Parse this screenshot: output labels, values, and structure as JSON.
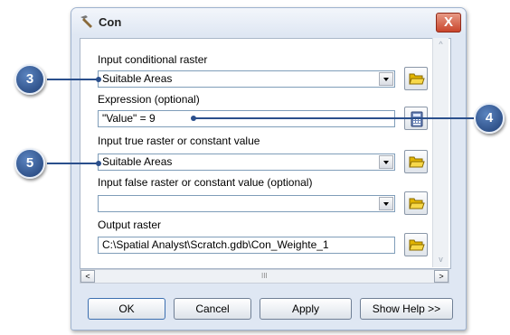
{
  "window": {
    "title": "Con",
    "close_label": "X"
  },
  "fields": {
    "input_conditional_raster": {
      "label": "Input conditional raster",
      "value": "Suitable Areas"
    },
    "expression": {
      "label": "Expression (optional)",
      "value": "\"Value\" = 9"
    },
    "input_true": {
      "label": "Input true raster or constant value",
      "value": "Suitable Areas"
    },
    "input_false": {
      "label": "Input false raster or constant value (optional)",
      "value": ""
    },
    "output_raster": {
      "label": "Output raster",
      "value": "C:\\Spatial  Analyst\\Scratch.gdb\\Con_Weighte_1"
    }
  },
  "buttons": {
    "ok": "OK",
    "cancel": "Cancel",
    "apply": "Apply",
    "show_help": "Show Help >>"
  },
  "scrollbar": {
    "left": "<",
    "right": ">",
    "grip": "III",
    "up": "^",
    "down": "v"
  },
  "callouts": {
    "c3": "3",
    "c4": "4",
    "c5": "5"
  },
  "colors": {
    "callout": "#2a4f8c",
    "accent": "#2a4f8c",
    "close": "#c9452c",
    "dialog_bg": "#dfe7f3"
  },
  "icons": {
    "open_folder": "open-folder-icon",
    "expression_builder": "calculator-icon",
    "title": "hammer-icon"
  }
}
